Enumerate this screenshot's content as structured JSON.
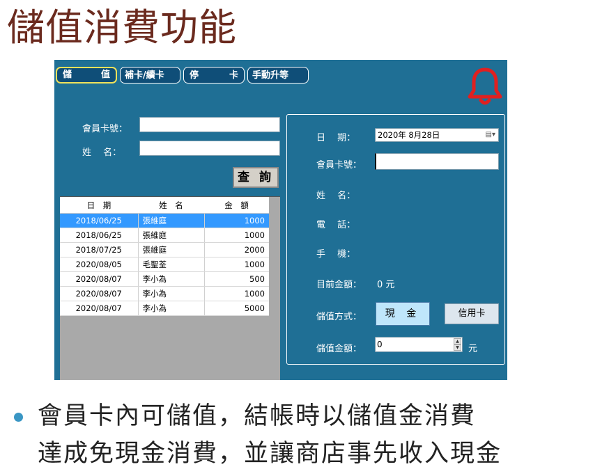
{
  "slide": {
    "title": "儲值消費功能",
    "bullet_line1": "會員卡內可儲值，結帳時以儲值金消費",
    "bullet_line2": "達成免現金消費，並讓商店事先收入現金"
  },
  "tabs": [
    {
      "left": "儲",
      "right": "值",
      "active": true
    },
    {
      "label": "補卡/續卡"
    },
    {
      "left": "停",
      "right": "卡"
    },
    {
      "label": "手動升等"
    }
  ],
  "search": {
    "card_label": "會員卡號：",
    "name_label": "姓　 名：",
    "card_value": "",
    "name_value": "",
    "query_button": "查 詢"
  },
  "history": {
    "columns": [
      "日　期",
      "姓　名",
      "金　額"
    ],
    "rows": [
      {
        "date": "2018/06/25",
        "name": "張維庭",
        "amount": "1000",
        "selected": true
      },
      {
        "date": "2018/06/25",
        "name": "張維庭",
        "amount": "1000"
      },
      {
        "date": "2018/07/25",
        "name": "張維庭",
        "amount": "2000"
      },
      {
        "date": "2020/08/05",
        "name": "毛聖荃",
        "amount": "1000"
      },
      {
        "date": "2020/08/07",
        "name": "李小為",
        "amount": "500"
      },
      {
        "date": "2020/08/07",
        "name": "李小為",
        "amount": "1000"
      },
      {
        "date": "2020/08/07",
        "name": "李小為",
        "amount": "5000"
      }
    ]
  },
  "form": {
    "date_label": "日　 期：",
    "date_value": "2020年  8月28日",
    "card_label": "會員卡號：",
    "card_value": "",
    "name_label": "姓　 名：",
    "phone_label": "電　 話：",
    "mobile_label": "手　 機：",
    "balance_label": "目前金額：",
    "balance_value": "0 元",
    "method_label": "儲值方式：",
    "cash_button": "現 金",
    "credit_button": "信用卡",
    "amount_label": "儲值金額：",
    "amount_value": "0",
    "amount_unit": "元"
  },
  "icons": {
    "alert": "bell-icon",
    "calendar": "calendar-icon"
  },
  "colors": {
    "panel_bg": "#1f6f95",
    "tab_bg": "#0f4e78",
    "active_tab_border": "#f1e25a",
    "bell": "#e02020",
    "selected_row": "#3399ff",
    "title": "#6b2a1e"
  }
}
